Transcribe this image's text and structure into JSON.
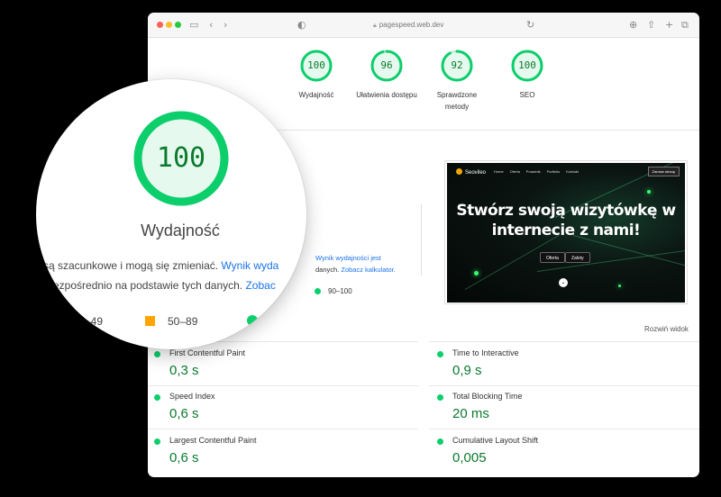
{
  "browser": {
    "url": "pagespeed.web.dev"
  },
  "scores": [
    {
      "value": "100",
      "label": "Wydajność",
      "fraction": 1.0
    },
    {
      "value": "96",
      "label": "Ułatwienia dostępu",
      "fraction": 0.96
    },
    {
      "value": "92",
      "label": "Sprawdzone metody",
      "fraction": 0.92
    },
    {
      "value": "100",
      "label": "SEO",
      "fraction": 1.0
    }
  ],
  "magnifier": {
    "score": "100",
    "title": "Wydajność",
    "line1": "są szacunkowe i mogą się zmieniać. ",
    "line1_link": "Wynik wyda",
    "line2": "ezpośrednio na podstawie tych danych. ",
    "line2_link": "Zobac",
    "legend_low": "–49",
    "legend_mid": "50–89"
  },
  "info": {
    "link1": "Wynik wydajności jest",
    "text2": "danych. ",
    "link2": "Zobacz kalkulator.",
    "legend_good": "90–100"
  },
  "preview": {
    "logo": "Seovileo",
    "nav": [
      "Home",
      "Oferta",
      "Poradnik",
      "Portfolio",
      "Kontakt"
    ],
    "cta": "Zamów stronę",
    "headline": "Stwórz swoją wizytówkę w internecie z nami!",
    "btn1": "Oferta",
    "btn2": "Zalety",
    "expand_label": "Rozwiń widok"
  },
  "metrics": [
    {
      "name": "First Contentful Paint",
      "value": "0,3 s"
    },
    {
      "name": "Time to Interactive",
      "value": "0,9 s"
    },
    {
      "name": "Speed Index",
      "value": "0,6 s"
    },
    {
      "name": "Total Blocking Time",
      "value": "20 ms"
    },
    {
      "name": "Largest Contentful Paint",
      "value": "0,6 s"
    },
    {
      "name": "Cumulative Layout Shift",
      "value": "0,005"
    }
  ],
  "colors": {
    "good": "#0cce6b",
    "good_text": "#0a7a2e",
    "average": "#ffa400",
    "link": "#1a73e8"
  }
}
